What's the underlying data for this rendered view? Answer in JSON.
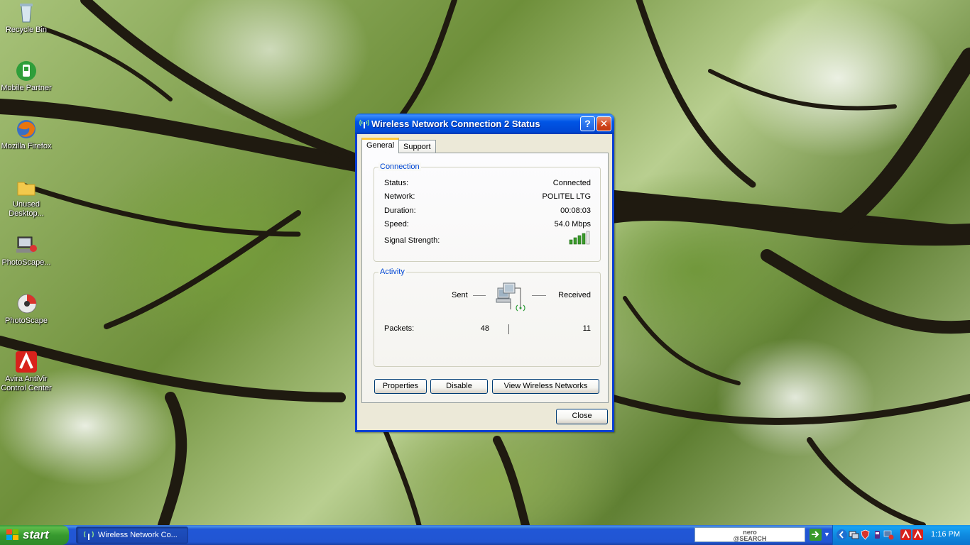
{
  "desktop": {
    "icons": [
      {
        "label": "Recycle Bin"
      },
      {
        "label": "Mobile Partner"
      },
      {
        "label": "Mozilla Firefox"
      },
      {
        "label": "Unused Desktop..."
      },
      {
        "label": "PhotoScape..."
      },
      {
        "label": "PhotoScape"
      },
      {
        "label": "Avira AntiVir Control Center"
      }
    ]
  },
  "dialog": {
    "title": "Wireless Network Connection 2 Status",
    "help_label": "?",
    "close_x_label": "✕",
    "tabs": [
      {
        "label": "General",
        "active": true
      },
      {
        "label": "Support",
        "active": false
      }
    ],
    "connection": {
      "title": "Connection",
      "rows": [
        {
          "label": "Status:",
          "value": "Connected"
        },
        {
          "label": "Network:",
          "value": "POLITEL LTG"
        },
        {
          "label": "Duration:",
          "value": "00:08:03"
        },
        {
          "label": "Speed:",
          "value": "54.0 Mbps"
        }
      ],
      "signal_label": "Signal Strength:",
      "signal_bars_lit": 4,
      "signal_bars_total": 5
    },
    "activity": {
      "title": "Activity",
      "sent_label": "Sent",
      "received_label": "Received",
      "packets_label": "Packets:",
      "packets_sent": "48",
      "packets_received": "11"
    },
    "buttons": {
      "properties": "Properties",
      "disable": "Disable",
      "view_wireless": "View Wireless Networks",
      "close": "Close"
    }
  },
  "taskbar": {
    "start_label": "start",
    "task_label": "Wireless Network Co...",
    "nero_line1": "nero",
    "nero_line2": "@SEARCH",
    "clock": "1:16 PM"
  },
  "colors": {
    "taskbar": "#2155d2",
    "start_green": "#379a2f",
    "dialog_title": "#0055e5",
    "group_title": "#0046d5",
    "signal_green": "#3a9a2a"
  }
}
